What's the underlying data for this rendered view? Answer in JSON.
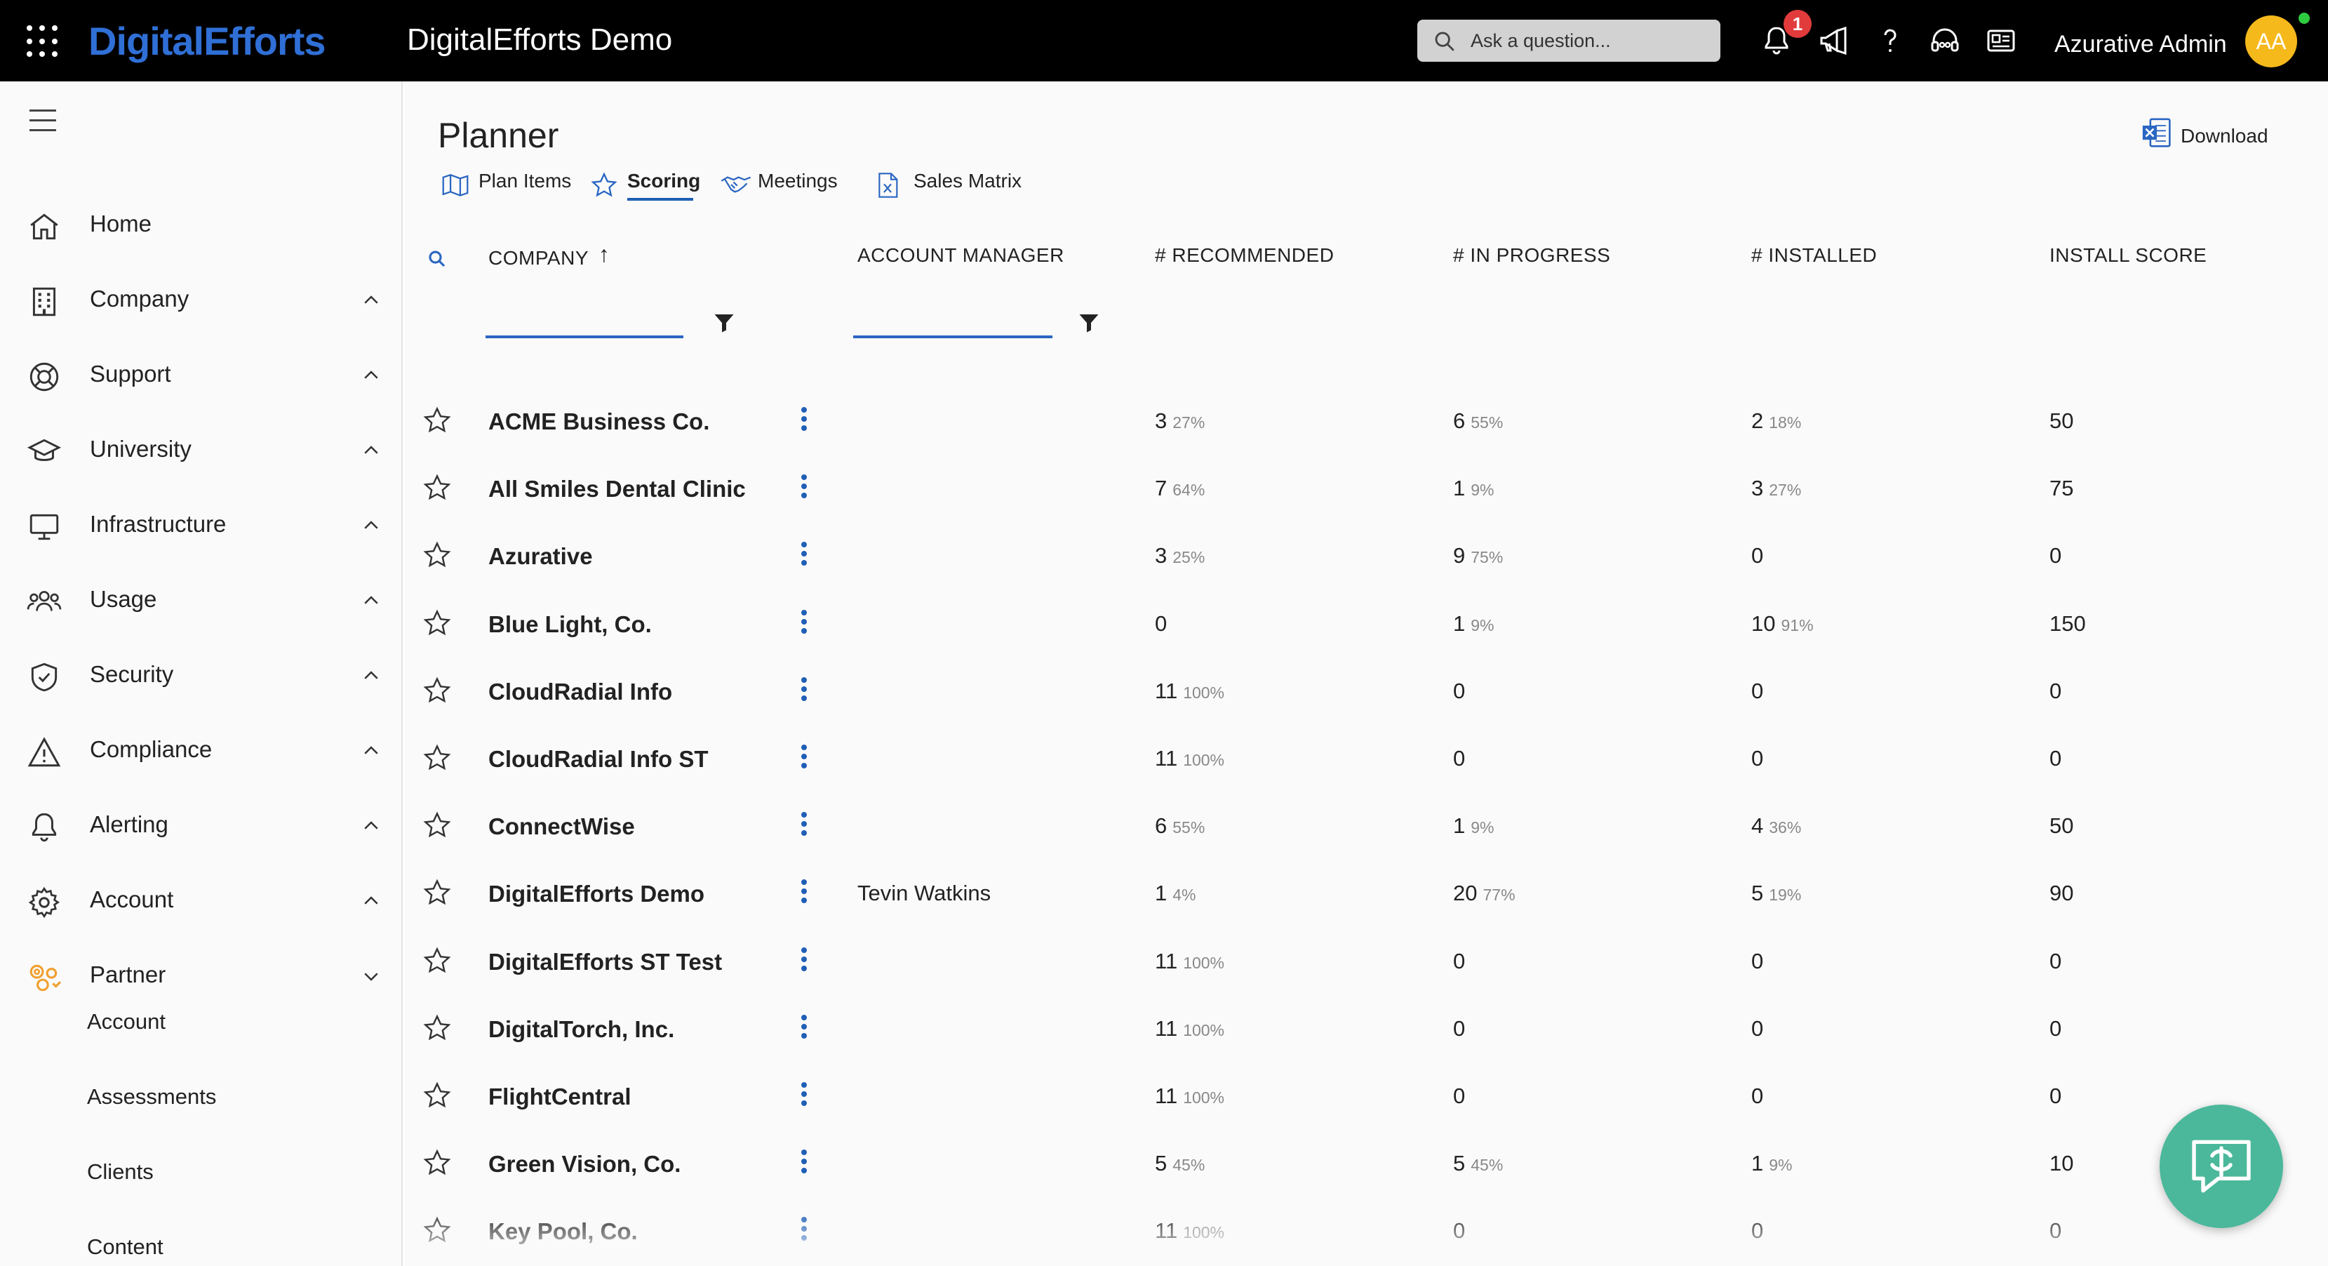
{
  "topbar": {
    "logo": "DigitalEfforts",
    "title": "DigitalEfforts Demo",
    "search_placeholder": "Ask a question...",
    "notification_count": "1",
    "user_name": "Azurative Admin",
    "avatar_initials": "AA"
  },
  "sidebar": {
    "items": [
      {
        "label": "Home",
        "icon": "home-icon"
      },
      {
        "label": "Company",
        "icon": "building-icon"
      },
      {
        "label": "Support",
        "icon": "lifebuoy-icon"
      },
      {
        "label": "University",
        "icon": "graduation-cap-icon"
      },
      {
        "label": "Infrastructure",
        "icon": "monitor-icon"
      },
      {
        "label": "Usage",
        "icon": "users-icon"
      },
      {
        "label": "Security",
        "icon": "shield-icon"
      },
      {
        "label": "Compliance",
        "icon": "warning-icon"
      },
      {
        "label": "Alerting",
        "icon": "bell-icon"
      },
      {
        "label": "Account",
        "icon": "gear-icon"
      },
      {
        "label": "Partner",
        "icon": "partner-gears-icon"
      }
    ],
    "partner_sub_items": [
      "Account",
      "Assessments",
      "Clients",
      "Content"
    ],
    "accent_color": "#f0a030"
  },
  "page": {
    "title": "Planner",
    "download_label": "Download",
    "tabs": [
      {
        "label": "Plan Items",
        "icon": "map-icon"
      },
      {
        "label": "Scoring",
        "icon": "star-icon",
        "active": true
      },
      {
        "label": "Meetings",
        "icon": "handshake-icon"
      },
      {
        "label": "Sales Matrix",
        "icon": "excel-file-icon"
      }
    ]
  },
  "table": {
    "headers": {
      "company": "COMPANY",
      "sort_indicator": "↑",
      "account_manager": "ACCOUNT MANAGER",
      "recommended": "# RECOMMENDED",
      "in_progress": "# IN PROGRESS",
      "installed": "# INSTALLED",
      "install_score": "INSTALL SCORE"
    },
    "rows": [
      {
        "company": "ACME Business Co.",
        "manager": "",
        "rec": "3",
        "rec_pct": "27%",
        "prog": "6",
        "prog_pct": "55%",
        "inst": "2",
        "inst_pct": "18%",
        "score": "50"
      },
      {
        "company": "All Smiles Dental Clinic",
        "manager": "",
        "rec": "7",
        "rec_pct": "64%",
        "prog": "1",
        "prog_pct": "9%",
        "inst": "3",
        "inst_pct": "27%",
        "score": "75"
      },
      {
        "company": "Azurative",
        "manager": "",
        "rec": "3",
        "rec_pct": "25%",
        "prog": "9",
        "prog_pct": "75%",
        "inst": "0",
        "inst_pct": "",
        "score": "0"
      },
      {
        "company": "Blue Light, Co.",
        "manager": "",
        "rec": "0",
        "rec_pct": "",
        "prog": "1",
        "prog_pct": "9%",
        "inst": "10",
        "inst_pct": "91%",
        "score": "150"
      },
      {
        "company": "CloudRadial Info",
        "manager": "",
        "rec": "11",
        "rec_pct": "100%",
        "prog": "0",
        "prog_pct": "",
        "inst": "0",
        "inst_pct": "",
        "score": "0"
      },
      {
        "company": "CloudRadial Info ST",
        "manager": "",
        "rec": "11",
        "rec_pct": "100%",
        "prog": "0",
        "prog_pct": "",
        "inst": "0",
        "inst_pct": "",
        "score": "0"
      },
      {
        "company": "ConnectWise",
        "manager": "",
        "rec": "6",
        "rec_pct": "55%",
        "prog": "1",
        "prog_pct": "9%",
        "inst": "4",
        "inst_pct": "36%",
        "score": "50"
      },
      {
        "company": "DigitalEfforts Demo",
        "manager": "Tevin Watkins",
        "rec": "1",
        "rec_pct": "4%",
        "prog": "20",
        "prog_pct": "77%",
        "inst": "5",
        "inst_pct": "19%",
        "score": "90"
      },
      {
        "company": "DigitalEfforts ST Test",
        "manager": "",
        "rec": "11",
        "rec_pct": "100%",
        "prog": "0",
        "prog_pct": "",
        "inst": "0",
        "inst_pct": "",
        "score": "0"
      },
      {
        "company": "DigitalTorch, Inc.",
        "manager": "",
        "rec": "11",
        "rec_pct": "100%",
        "prog": "0",
        "prog_pct": "",
        "inst": "0",
        "inst_pct": "",
        "score": "0"
      },
      {
        "company": "FlightCentral",
        "manager": "",
        "rec": "11",
        "rec_pct": "100%",
        "prog": "0",
        "prog_pct": "",
        "inst": "0",
        "inst_pct": "",
        "score": "0"
      },
      {
        "company": "Green Vision, Co.",
        "manager": "",
        "rec": "5",
        "rec_pct": "45%",
        "prog": "5",
        "prog_pct": "45%",
        "inst": "1",
        "inst_pct": "9%",
        "score": "10"
      },
      {
        "company": "Key Pool, Co.",
        "manager": "",
        "rec": "11",
        "rec_pct": "100%",
        "prog": "0",
        "prog_pct": "",
        "inst": "0",
        "inst_pct": "",
        "score": "0"
      }
    ]
  }
}
